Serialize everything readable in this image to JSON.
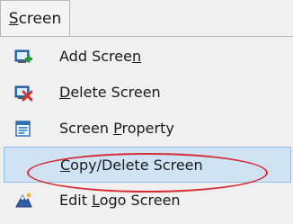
{
  "menubar": {
    "title_prefix": "",
    "title_mnemonic": "S",
    "title_rest": "creen"
  },
  "menu": {
    "items": [
      {
        "before": "Add Scree",
        "mnemonic": "n",
        "after": "",
        "icon": "add-screen-icon"
      },
      {
        "before": "",
        "mnemonic": "D",
        "after": "elete Screen",
        "icon": "delete-screen-icon"
      },
      {
        "before": "Screen ",
        "mnemonic": "P",
        "after": "roperty",
        "icon": "screen-property-icon"
      },
      {
        "before": "",
        "mnemonic": "C",
        "after": "opy/Delete Screen",
        "icon": "none",
        "highlighted": true
      },
      {
        "before": "Edit ",
        "mnemonic": "L",
        "after": "ogo Screen",
        "icon": "edit-logo-screen-icon"
      }
    ]
  },
  "colors": {
    "highlight_fill": "#cfe3f5",
    "highlight_border": "#94bde3",
    "annotation_ellipse": "#d62b32",
    "menu_background": "#f0f0f0"
  }
}
